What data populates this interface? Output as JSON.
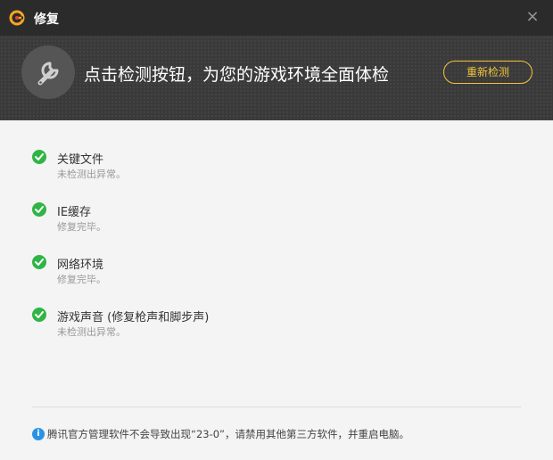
{
  "window": {
    "title": "修复",
    "close_label": "×"
  },
  "header": {
    "message": "点击检测按钮，为您的游戏环境全面体检",
    "recheck_label": "重新检测"
  },
  "items": [
    {
      "name": "关键文件",
      "status": "未检测出异常。"
    },
    {
      "name": "IE缓存",
      "status": "修复完毕。"
    },
    {
      "name": "网络环境",
      "status": "修复完毕。"
    },
    {
      "name": "游戏声音 (修复枪声和脚步声)",
      "status": "未检测出异常。"
    }
  ],
  "footer": {
    "info_glyph": "i",
    "notice": "腾讯官方管理软件不会导致出现“23-0”，请禁用其他第三方软件，并重启电脑。"
  },
  "colors": {
    "accent": "#f3c43c",
    "success": "#2fb544",
    "info": "#2a93e6"
  }
}
